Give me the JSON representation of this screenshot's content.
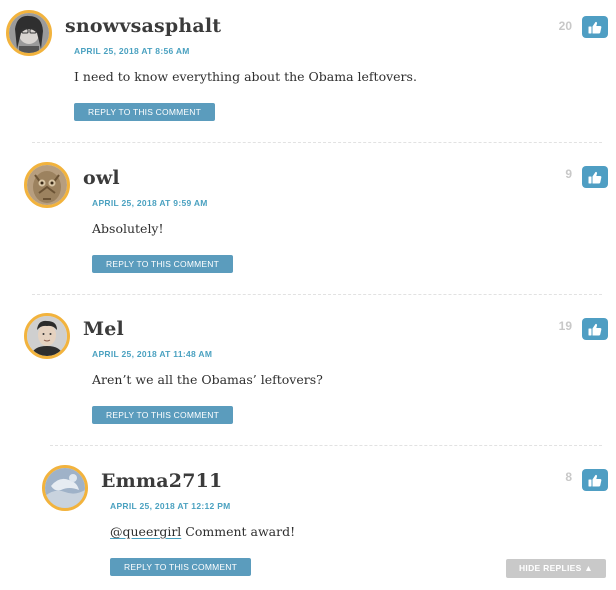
{
  "comments": [
    {
      "author": "snowvsasphalt",
      "timestamp": "APRIL 25, 2018 AT 8:56 AM",
      "text": "I need to know everything about the Obama leftovers.",
      "score": "20",
      "reply_label": "REPLY TO THIS COMMENT"
    },
    {
      "author": "owl",
      "timestamp": "APRIL 25, 2018 AT 9:59 AM",
      "text": "Absolutely!",
      "score": "9",
      "reply_label": "REPLY TO THIS COMMENT"
    },
    {
      "author": "Mel",
      "timestamp": "APRIL 25, 2018 AT 11:48 AM",
      "text": "Aren’t we all the Obamas’ leftovers?",
      "score": "19",
      "reply_label": "REPLY TO THIS COMMENT"
    },
    {
      "author": "Emma2711",
      "timestamp": "APRIL 25, 2018 AT 12:12 PM",
      "mention": "@queergirl",
      "text": " Comment award!",
      "score": "8",
      "reply_label": "REPLY TO THIS COMMENT"
    }
  ],
  "hide_replies_label": "HIDE REPLIES ▲",
  "icons": {
    "like": "thumbs-up-icon",
    "caret": "caret-up-icon"
  },
  "colors": {
    "accent": "#4aa1c0",
    "button": "#5b9cbd",
    "like_button": "#4f9ec3",
    "avatar_ring": "#f2b33d",
    "score": "#c8c8c8",
    "hide_replies": "#c9c9c9"
  }
}
